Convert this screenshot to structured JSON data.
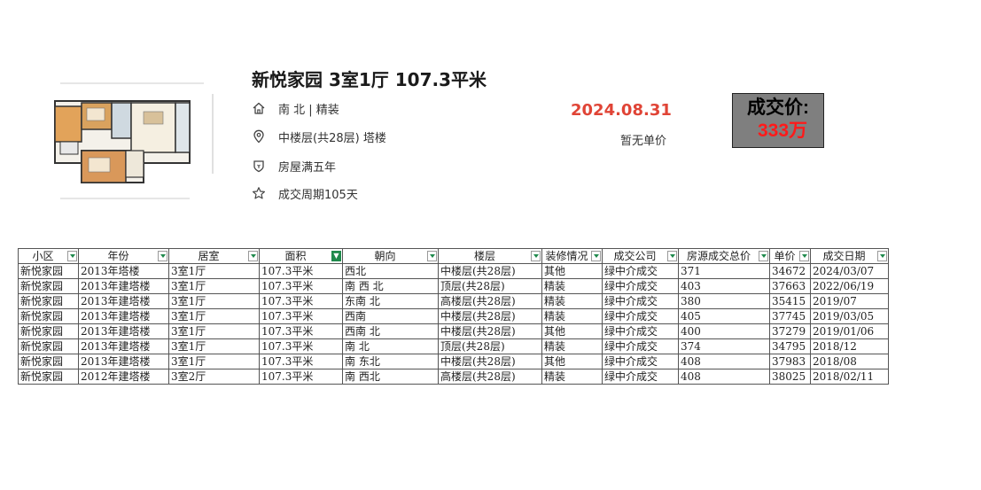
{
  "listing": {
    "title": "新悦家园 3室1厅 107.3平米",
    "orientation_decoration": "南 北 | 精装",
    "floor_info": "中楼层(共28层) 塔楼",
    "ownership": "房屋满五年",
    "deal_cycle": "成交周期105天",
    "deal_date": "2024.08.31",
    "unit_price_note": "暂无单价"
  },
  "price_box": {
    "label": "成交价:",
    "value": "333万"
  },
  "icons": {
    "orientation": "home-icon",
    "floor": "location-pin-icon",
    "ownership": "shield-icon",
    "deal_cycle": "star-icon"
  },
  "colors": {
    "deal_date": "#e04436",
    "price_value": "#ff1a1a",
    "price_box_bg": "#7f7f7f",
    "filter_active": "#1f8a4c"
  },
  "table": {
    "headers": [
      "小区",
      "年份",
      "居室",
      "面积",
      "朝向",
      "楼层",
      "装修情况",
      "成交公司",
      "房源成交总价",
      "单价",
      "成交日期"
    ],
    "active_filter_column": 3,
    "rows": [
      [
        "新悦家园",
        "2013年塔楼",
        "3室1厅",
        "107.3平米",
        "西北",
        "中楼层(共28层)",
        "其他",
        "绿中介成交",
        "371",
        "34672",
        "2024/03/07"
      ],
      [
        "新悦家园",
        "2013年建塔楼",
        "3室1厅",
        "107.3平米",
        "南 西 北",
        "顶层(共28层)",
        "精装",
        "绿中介成交",
        "403",
        "37663",
        "2022/06/19"
      ],
      [
        "新悦家园",
        "2013年建塔楼",
        "3室1厅",
        "107.3平米",
        "东南 北",
        "高楼层(共28层)",
        "精装",
        "绿中介成交",
        "380",
        "35415",
        "2019/07"
      ],
      [
        "新悦家园",
        "2013年建塔楼",
        "3室1厅",
        "107.3平米",
        "西南",
        "中楼层(共28层)",
        "精装",
        "绿中介成交",
        "405",
        "37745",
        "2019/03/05"
      ],
      [
        "新悦家园",
        "2013年建塔楼",
        "3室1厅",
        "107.3平米",
        "西南 北",
        "中楼层(共28层)",
        "其他",
        "绿中介成交",
        "400",
        "37279",
        "2019/01/06"
      ],
      [
        "新悦家园",
        "2013年建塔楼",
        "3室1厅",
        "107.3平米",
        "南 北",
        "顶层(共28层)",
        "精装",
        "绿中介成交",
        "374",
        "34795",
        "2018/12"
      ],
      [
        "新悦家园",
        "2013年建塔楼",
        "3室1厅",
        "107.3平米",
        "南 东北",
        "中楼层(共28层)",
        "其他",
        "绿中介成交",
        "408",
        "37983",
        "2018/08"
      ],
      [
        "新悦家园",
        "2012年建塔楼",
        "3室2厅",
        "107.3平米",
        "南 西北",
        "高楼层(共28层)",
        "精装",
        "绿中介成交",
        "408",
        "38025",
        "2018/02/11"
      ]
    ]
  }
}
